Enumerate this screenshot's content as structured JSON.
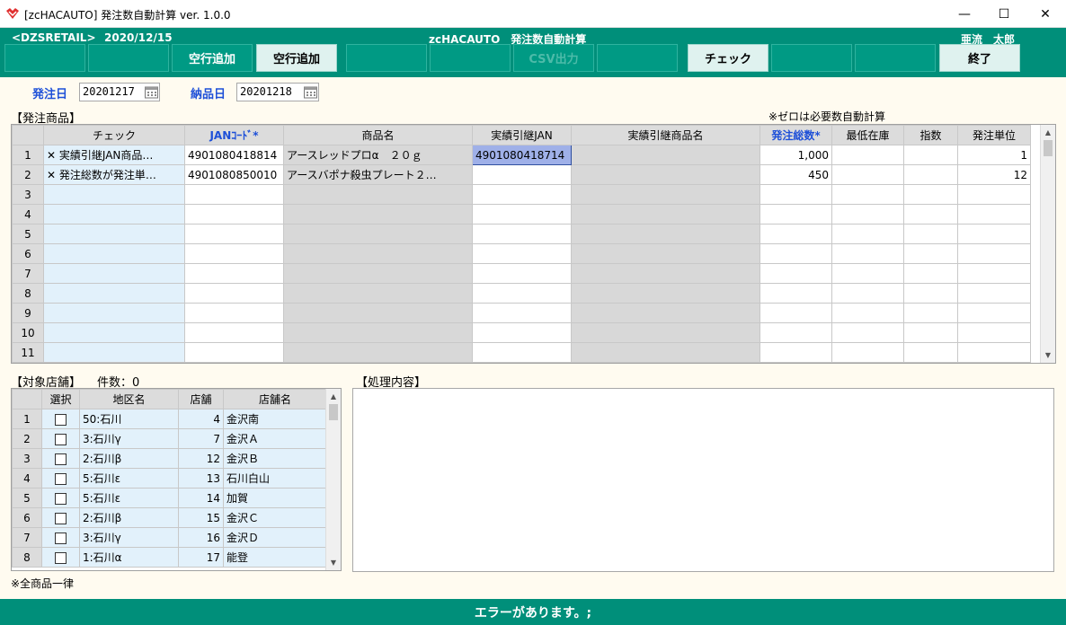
{
  "window": {
    "title": "[zcHACAUTO] 発注数自動計算 ver. 1.0.0",
    "min": "—",
    "max": "☐",
    "close": "✕"
  },
  "header": {
    "store_code": "<DZSRETAIL>",
    "date": "2020/12/15",
    "app_name": "zcHACAUTO　発注数自動計算",
    "user": "亜流　太郎"
  },
  "function_buttons": [
    "",
    "",
    "空行追加",
    "",
    "",
    "CSV出力",
    "",
    "チェック",
    "",
    "",
    "終了"
  ],
  "dates": {
    "order_date_label": "発注日",
    "order_date": "20201217",
    "delivery_date_label": "納品日",
    "delivery_date": "20201218"
  },
  "products": {
    "section_label": "【発注商品】",
    "note": "※ゼロは必要数自動計算",
    "columns": [
      "チェック",
      "JANｺｰﾄﾞ*",
      "商品名",
      "実績引継JAN",
      "実績引継商品名",
      "発注総数*",
      "最低在庫",
      "指数",
      "発注単位"
    ],
    "rows": [
      {
        "no": "1",
        "check": "✕ 実績引継JAN商品…",
        "jan": "4901080418814",
        "name": "アースレッドプロα　２０ｇ",
        "ref_jan": "4901080418714",
        "ref_name": "",
        "qty": "1,000",
        "min": "",
        "idx": "",
        "unit": "1"
      },
      {
        "no": "2",
        "check": "✕ 発注総数が発注単…",
        "jan": "4901080850010",
        "name": "アースバポナ殺虫プレート２…",
        "ref_jan": "",
        "ref_name": "",
        "qty": "450",
        "min": "",
        "idx": "",
        "unit": "12"
      },
      {
        "no": "3",
        "check": "",
        "jan": "",
        "name": "",
        "ref_jan": "",
        "ref_name": "",
        "qty": "",
        "min": "",
        "idx": "",
        "unit": ""
      },
      {
        "no": "4",
        "check": "",
        "jan": "",
        "name": "",
        "ref_jan": "",
        "ref_name": "",
        "qty": "",
        "min": "",
        "idx": "",
        "unit": ""
      },
      {
        "no": "5",
        "check": "",
        "jan": "",
        "name": "",
        "ref_jan": "",
        "ref_name": "",
        "qty": "",
        "min": "",
        "idx": "",
        "unit": ""
      },
      {
        "no": "6",
        "check": "",
        "jan": "",
        "name": "",
        "ref_jan": "",
        "ref_name": "",
        "qty": "",
        "min": "",
        "idx": "",
        "unit": ""
      },
      {
        "no": "7",
        "check": "",
        "jan": "",
        "name": "",
        "ref_jan": "",
        "ref_name": "",
        "qty": "",
        "min": "",
        "idx": "",
        "unit": ""
      },
      {
        "no": "8",
        "check": "",
        "jan": "",
        "name": "",
        "ref_jan": "",
        "ref_name": "",
        "qty": "",
        "min": "",
        "idx": "",
        "unit": ""
      },
      {
        "no": "9",
        "check": "",
        "jan": "",
        "name": "",
        "ref_jan": "",
        "ref_name": "",
        "qty": "",
        "min": "",
        "idx": "",
        "unit": ""
      },
      {
        "no": "10",
        "check": "",
        "jan": "",
        "name": "",
        "ref_jan": "",
        "ref_name": "",
        "qty": "",
        "min": "",
        "idx": "",
        "unit": ""
      },
      {
        "no": "11",
        "check": "",
        "jan": "",
        "name": "",
        "ref_jan": "",
        "ref_name": "",
        "qty": "",
        "min": "",
        "idx": "",
        "unit": ""
      }
    ]
  },
  "stores": {
    "section_label": "【対象店舗】",
    "count_label": "件数：0",
    "columns": [
      "選択",
      "地区名",
      "店舗",
      "店舗名"
    ],
    "rows": [
      {
        "no": "1",
        "area": "50:石川",
        "store_no": "4",
        "store_name": "金沢南"
      },
      {
        "no": "2",
        "area": "3:石川γ",
        "store_no": "7",
        "store_name": "金沢Ａ"
      },
      {
        "no": "3",
        "area": "2:石川β",
        "store_no": "12",
        "store_name": "金沢Ｂ"
      },
      {
        "no": "4",
        "area": "5:石川ε",
        "store_no": "13",
        "store_name": "石川白山"
      },
      {
        "no": "5",
        "area": "5:石川ε",
        "store_no": "14",
        "store_name": "加賀"
      },
      {
        "no": "6",
        "area": "2:石川β",
        "store_no": "15",
        "store_name": "金沢Ｃ"
      },
      {
        "no": "7",
        "area": "3:石川γ",
        "store_no": "16",
        "store_name": "金沢Ｄ"
      },
      {
        "no": "8",
        "area": "1:石川α",
        "store_no": "17",
        "store_name": "能登"
      }
    ],
    "footnote": "※全商品一律"
  },
  "process": {
    "label": "【処理内容】"
  },
  "status": {
    "message": "エラーがあります。;"
  },
  "colors": {
    "header": "#008f7a",
    "accent_blue": "#1e50d8",
    "selected_cell": "#9fb0e8"
  }
}
